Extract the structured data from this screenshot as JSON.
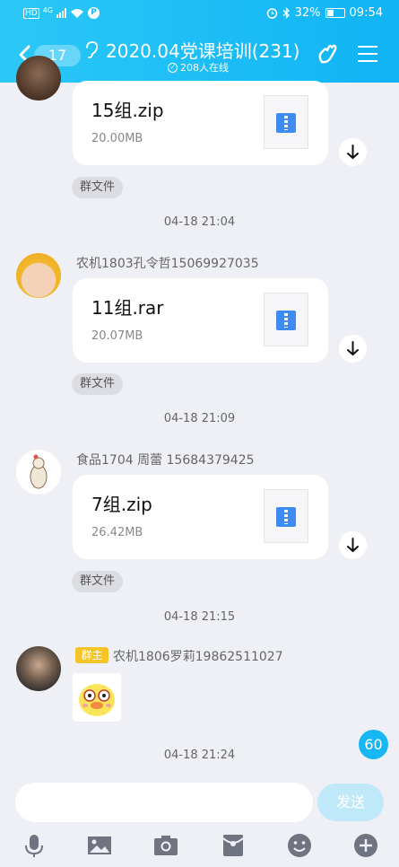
{
  "status_bar": {
    "hd": "HD",
    "network": "4G",
    "battery_pct": "32%",
    "time": "09:54"
  },
  "header": {
    "unread_count": "17",
    "title": "2020.04党课培训(231)",
    "online": "208人在线"
  },
  "messages": [
    {
      "type": "file",
      "file_name": "15组.zip",
      "file_size": "20.00MB",
      "tag": "群文件"
    },
    {
      "type": "time",
      "text": "04-18 21:04"
    },
    {
      "type": "file",
      "sender": "农机1803孔令哲15069927035",
      "file_name": "11组.rar",
      "file_size": "20.07MB",
      "tag": "群文件"
    },
    {
      "type": "time",
      "text": "04-18 21:09"
    },
    {
      "type": "file",
      "sender": "食品1704 周蕾 15684379425",
      "file_name": "7组.zip",
      "file_size": "26.42MB",
      "tag": "群文件"
    },
    {
      "type": "time",
      "text": "04-18 21:15"
    },
    {
      "type": "sticker",
      "role_badge": "群主",
      "sender": "农机1806罗莉19862511027"
    },
    {
      "type": "time",
      "text": "04-18 21:24"
    }
  ],
  "unread_badge": "60",
  "input": {
    "placeholder": "",
    "send_label": "发送"
  },
  "toolbar": [
    "microphone-icon",
    "image-icon",
    "camera-icon",
    "red-packet-icon",
    "emoji-icon",
    "plus-icon"
  ],
  "colors": {
    "header": "#10b4f5",
    "background": "#eef0f5",
    "file_icon": "#3e8bf4",
    "owner_badge": "#f5c528"
  }
}
